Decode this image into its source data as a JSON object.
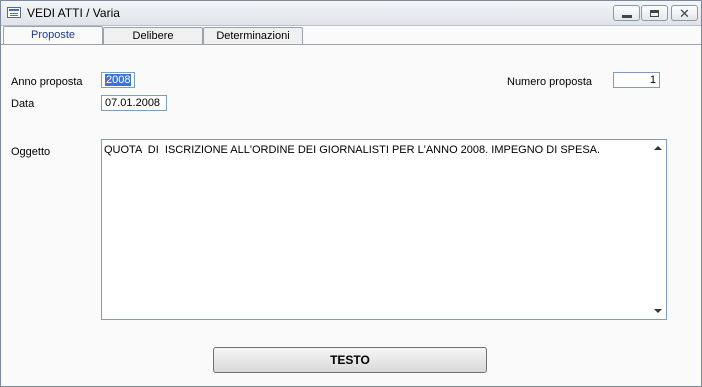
{
  "window": {
    "title": "VEDI ATTI / Varia"
  },
  "tabs": [
    {
      "label": "Proposte"
    },
    {
      "label": "Delibere"
    },
    {
      "label": "Determinazioni"
    }
  ],
  "form": {
    "anno_label": "Anno proposta",
    "anno_value": "2008",
    "data_label": "Data",
    "data_value": "07.01.2008",
    "numero_label": "Numero proposta",
    "numero_value": "1",
    "oggetto_label": "Oggetto",
    "oggetto_value": "QUOTA  DI  ISCRIZIONE ALL'ORDINE DEI GIORNALISTI PER L'ANNO 2008. IMPEGNO DI SPESA."
  },
  "buttons": {
    "testo_label": "TESTO"
  },
  "icons": {
    "app": "window-app-icon",
    "minimize": "minimize-icon",
    "maximize": "maximize-icon",
    "close": "close-icon"
  }
}
